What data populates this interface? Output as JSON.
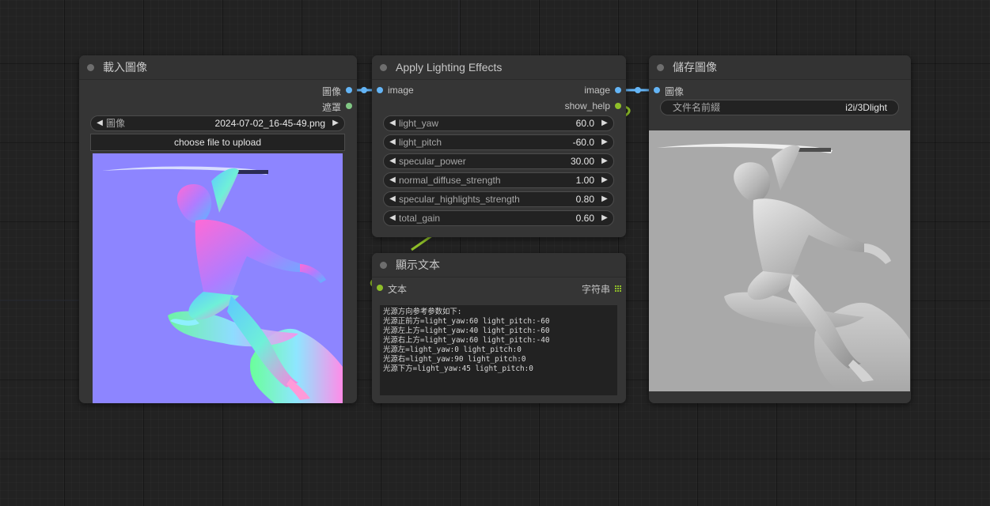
{
  "colors": {
    "canvas_bg": "#222222",
    "node_bg": "#353535",
    "image_link": "#64b5f6",
    "mask_link": "#81c784",
    "string_link": "#8fbf29"
  },
  "load_image_node": {
    "title": "載入圖像",
    "outputs": {
      "image": "圖像",
      "mask": "遮罩"
    },
    "image_widget": {
      "label": "圖像",
      "value": "2024-07-02_16-45-49.png"
    },
    "upload_button": "choose file to upload",
    "preview": {
      "icon": "normal-map-image"
    }
  },
  "lighting_node": {
    "title": "Apply Lighting Effects",
    "inputs": {
      "image": "image"
    },
    "outputs": {
      "image": "image",
      "show_help": "show_help"
    },
    "widgets": [
      {
        "name": "light_yaw",
        "value": "60.0"
      },
      {
        "name": "light_pitch",
        "value": "-60.0"
      },
      {
        "name": "specular_power",
        "value": "30.00"
      },
      {
        "name": "normal_diffuse_strength",
        "value": "1.00"
      },
      {
        "name": "specular_highlights_strength",
        "value": "0.80"
      },
      {
        "name": "total_gain",
        "value": "0.60"
      }
    ]
  },
  "text_node": {
    "title": "顯示文本",
    "inputs": {
      "text": "文本"
    },
    "outputs": {
      "string": "字符串"
    },
    "lines": [
      "光源方向参考参数如下:",
      "光源正前方=light_yaw:60 light_pitch:-60",
      "光源左上方=light_yaw:40 light_pitch:-60",
      "光源右上方=light_yaw:60 light_pitch:-40",
      "光源左=light_yaw:0 light_pitch:0",
      "光源右=light_yaw:90 light_pitch:0",
      "光源下方=light_yaw:45 light_pitch:0"
    ]
  },
  "save_node": {
    "title": "儲存圖像",
    "inputs": {
      "image": "圖像"
    },
    "prefix_widget": {
      "label": "文件名前綴",
      "value": "i2i/3Dlight"
    },
    "preview": {
      "icon": "lit-grayscale-image"
    }
  }
}
